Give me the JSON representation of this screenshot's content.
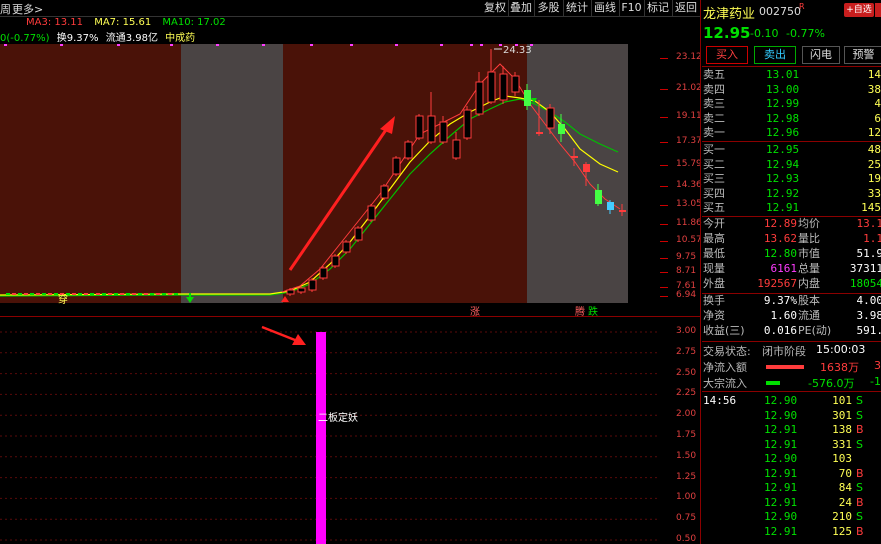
{
  "toolbar": {
    "left_cut": "周",
    "more": "更多>",
    "buttons": [
      "复权",
      "叠加",
      "多股",
      "统计",
      "画线",
      "F10",
      "标记",
      "返回"
    ]
  },
  "indicators": {
    "ma3": "MA3: 13.11",
    "ma7": "MA7: 15.61",
    "ma10": "MA10: 17.02",
    "change": "0(-0.77%)",
    "turnover": "换9.37%",
    "float": "流通3.98亿",
    "sector": "中成药"
  },
  "price_axis": [
    "23.12",
    "21.02",
    "19.11",
    "17.37",
    "15.79",
    "14.36",
    "13.05",
    "11.86",
    "10.57",
    "9.75",
    "8.71",
    "7.61",
    "6.94"
  ],
  "peak_label": "24.33",
  "lower_axis": [
    "3.00",
    "2.75",
    "2.50",
    "2.25",
    "2.00",
    "1.75",
    "1.50",
    "1.25",
    "1.00",
    "0.75",
    "0.50"
  ],
  "lower_label": "二板定妖",
  "chart_marks": {
    "buy_text": "穿",
    "zhang": "涨",
    "teng": "腾",
    "die": "跌"
  },
  "colors": {
    "up": "#ff3c3c",
    "down": "#00e000",
    "ma3": "#ffffff",
    "ma7": "#ffff00",
    "ma10": "#00c000",
    "magenta": "#ff00ff",
    "bg_red": "#4a1208",
    "bg_gray": "#4a4444"
  },
  "stock": {
    "name": "龙津药业",
    "code": "002750",
    "badge": "R",
    "add_btn": "+自选",
    "price": "12.95",
    "chg": "-0.10",
    "pct": "-0.77%",
    "actions": [
      "买入",
      "卖出",
      "闪电",
      "预警"
    ]
  },
  "asks": [
    {
      "label": "卖五",
      "price": "13.01",
      "vol": "14"
    },
    {
      "label": "卖四",
      "price": "13.00",
      "vol": "38"
    },
    {
      "label": "卖三",
      "price": "12.99",
      "vol": "4"
    },
    {
      "label": "卖二",
      "price": "12.98",
      "vol": "6"
    },
    {
      "label": "卖一",
      "price": "12.96",
      "vol": "12"
    }
  ],
  "bids": [
    {
      "label": "买一",
      "price": "12.95",
      "vol": "48"
    },
    {
      "label": "买二",
      "price": "12.94",
      "vol": "25"
    },
    {
      "label": "买三",
      "price": "12.93",
      "vol": "19"
    },
    {
      "label": "买四",
      "price": "12.92",
      "vol": "33"
    },
    {
      "label": "买五",
      "price": "12.91",
      "vol": "145"
    }
  ],
  "stats": [
    {
      "k1": "今开",
      "v1": "12.89",
      "k2": "均价",
      "v2": "13.1"
    },
    {
      "k1": "最高",
      "v1": "13.62",
      "k2": "量比",
      "v2": "1.1"
    },
    {
      "k1": "最低",
      "v1": "12.80",
      "k2": "市值",
      "v2": "51.9"
    },
    {
      "k1": "现量",
      "v1": "6161",
      "k2": "总量",
      "v2": "37311"
    },
    {
      "k1": "外盘",
      "v1": "192567",
      "k2": "内盘",
      "v2": "18054"
    }
  ],
  "stats2": [
    {
      "k1": "换手",
      "v1": "9.37%",
      "k2": "股本",
      "v2": "4.00"
    },
    {
      "k1": "净资",
      "v1": "1.60",
      "k2": "流通",
      "v2": "3.98"
    },
    {
      "k1": "收益(三)",
      "v1": "0.016",
      "k2": "PE(动)",
      "v2": "591."
    }
  ],
  "trade_status": {
    "label": "交易状态:",
    "value": "闭市阶段",
    "time": "15:00:03"
  },
  "flows": [
    {
      "label": "净流入额",
      "value": "1638万",
      "extra": "3"
    },
    {
      "label": "大宗流入",
      "value": "-576.0万",
      "extra": "-1"
    }
  ],
  "ticks": [
    {
      "time": "14:56",
      "price": "12.90",
      "vol": "101",
      "side": "S"
    },
    {
      "time": "",
      "price": "12.90",
      "vol": "301",
      "side": "S"
    },
    {
      "time": "",
      "price": "12.91",
      "vol": "138",
      "side": "B"
    },
    {
      "time": "",
      "price": "12.91",
      "vol": "331",
      "side": "S"
    },
    {
      "time": "",
      "price": "12.90",
      "vol": "103",
      "side": ""
    },
    {
      "time": "",
      "price": "12.91",
      "vol": "70",
      "side": "B"
    },
    {
      "time": "",
      "price": "12.91",
      "vol": "84",
      "side": "S"
    },
    {
      "time": "",
      "price": "12.91",
      "vol": "24",
      "side": "B"
    },
    {
      "time": "",
      "price": "12.90",
      "vol": "210",
      "side": "S"
    },
    {
      "time": "",
      "price": "12.91",
      "vol": "125",
      "side": "B"
    }
  ]
}
